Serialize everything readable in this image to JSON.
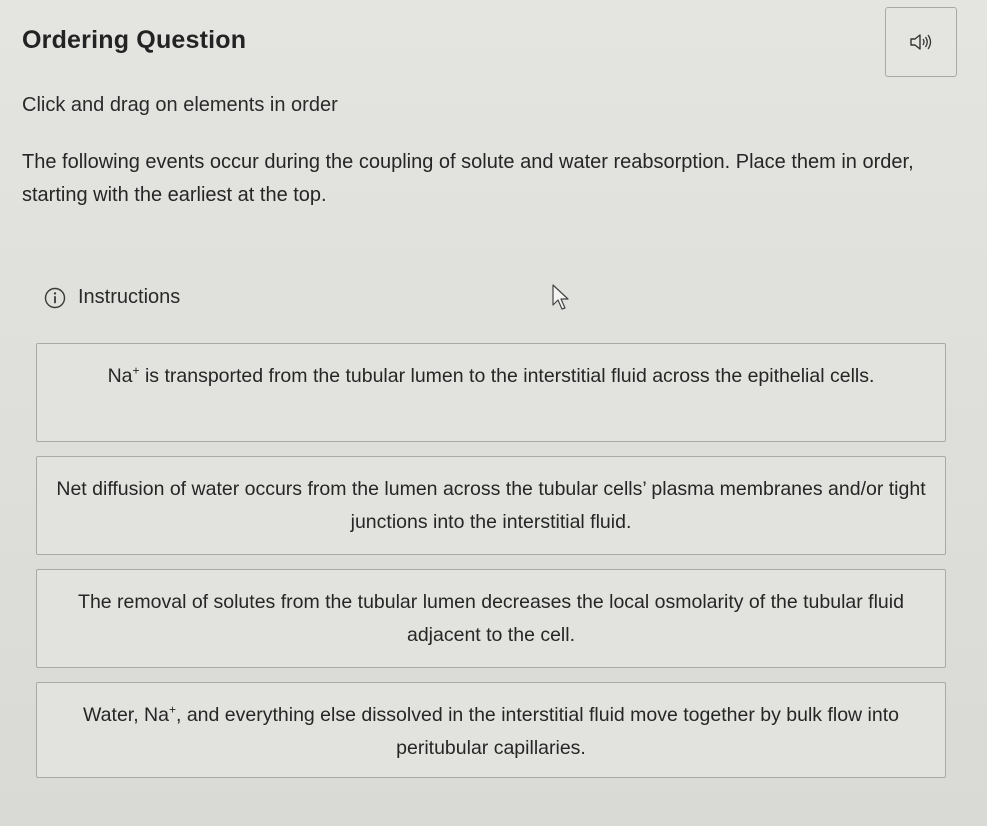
{
  "header": {
    "title": "Ordering Question",
    "audio_icon": "speaker-icon"
  },
  "question": {
    "instruction": "Click and drag on elements in order",
    "prompt": "The following events occur during the coupling of solute and water reabsorption. Place them in order, starting with the earliest at the top.",
    "instructions_link": "Instructions",
    "instructions_icon": "info-icon"
  },
  "items": [
    {
      "prefix": "Na",
      "superscript": "+",
      "text": " is transported from the tubular lumen to the interstitial fluid across the epithelial cells."
    },
    {
      "text": "Net diffusion of water occurs from the lumen across the tubular cells’ plasma membranes and/or tight junctions into the interstitial fluid."
    },
    {
      "text": "The removal of solutes from the tubular lumen decreases the local osmolarity of the tubular fluid adjacent to the cell."
    },
    {
      "prefix": "Water, Na",
      "superscript": "+",
      "text": ", and everything else dissolved in the interstitial fluid move together by bulk flow into peritubular capillaries."
    }
  ]
}
